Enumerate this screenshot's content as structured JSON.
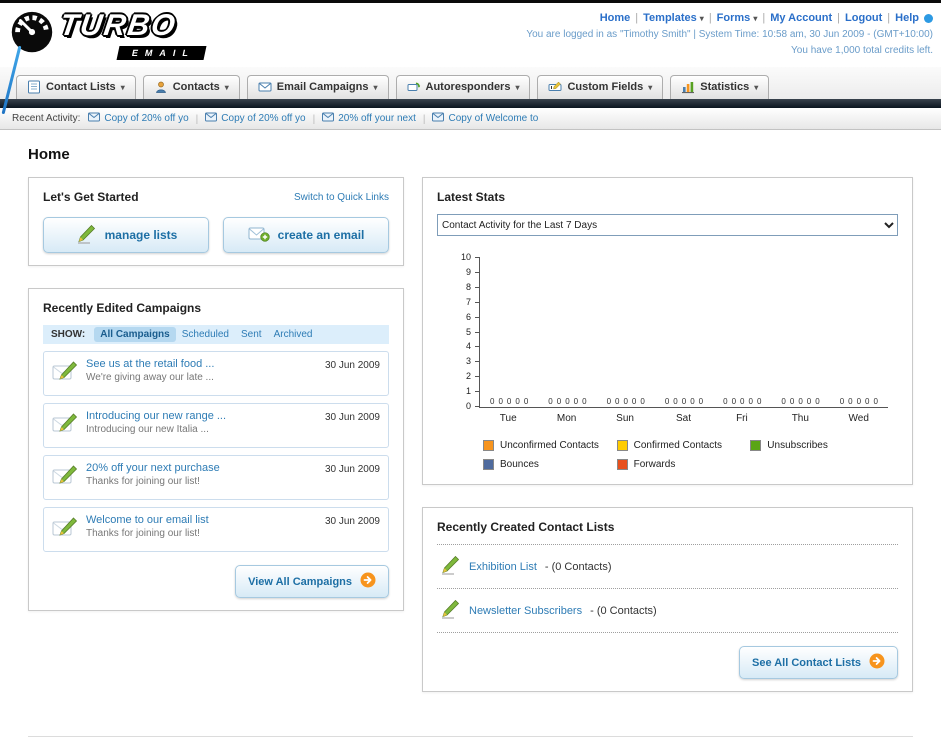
{
  "header": {
    "logo": {
      "line1": "TURBO",
      "line2": "EMAIL"
    },
    "nav_links": [
      {
        "label": "Home",
        "dropdown": false
      },
      {
        "label": "Templates",
        "dropdown": true
      },
      {
        "label": "Forms",
        "dropdown": true
      },
      {
        "label": "My Account",
        "dropdown": false
      },
      {
        "label": "Logout",
        "dropdown": false
      },
      {
        "label": "Help",
        "dropdown": false
      }
    ],
    "login_info": "You are logged in as \"Timothy Smith\" | System Time: 10:58 am, 30 Jun 2009 - (GMT+10:00)",
    "credits_info": "You have 1,000 total credits left."
  },
  "main_nav": {
    "tabs": [
      {
        "label": "Contact Lists",
        "icon": "list"
      },
      {
        "label": "Contacts",
        "icon": "person"
      },
      {
        "label": "Email Campaigns",
        "icon": "envelope"
      },
      {
        "label": "Autoresponders",
        "icon": "autoresponder"
      },
      {
        "label": "Custom Fields",
        "icon": "field"
      },
      {
        "label": "Statistics",
        "icon": "barchart"
      }
    ]
  },
  "recent_activity": {
    "label": "Recent Activity:",
    "items": [
      "Copy of 20% off yo",
      "Copy of 20% off yo",
      "20% off your next",
      "Copy of Welcome to"
    ]
  },
  "page_title": "Home",
  "get_started": {
    "title": "Let's Get Started",
    "switch_link": "Switch to Quick Links",
    "buttons": [
      {
        "label": "manage lists",
        "icon": "pencil"
      },
      {
        "label": "create an email",
        "icon": "envelope-plus"
      }
    ]
  },
  "campaigns": {
    "title": "Recently Edited Campaigns",
    "show_label": "SHOW:",
    "filters": [
      "All Campaigns",
      "Scheduled",
      "Sent",
      "Archived"
    ],
    "active_filter": "All Campaigns",
    "rows": [
      {
        "title": "See us at the retail food ...",
        "subtitle": "We're giving away our late ...",
        "date": "30 Jun 2009"
      },
      {
        "title": "Introducing our new range ...",
        "subtitle": "Introducing our new Italia ...",
        "date": "30 Jun 2009"
      },
      {
        "title": "20% off your next purchase",
        "subtitle": "Thanks for joining our list!",
        "date": "30 Jun 2009"
      },
      {
        "title": "Welcome to our email list",
        "subtitle": "Thanks for joining our list!",
        "date": "30 Jun 2009"
      }
    ],
    "view_all_label": "View All Campaigns"
  },
  "latest_stats": {
    "title": "Latest Stats",
    "dropdown_value": "Contact Activity for the Last 7 Days"
  },
  "chart_data": {
    "type": "bar",
    "title": "Contact Activity for the Last 7 Days",
    "categories": [
      "Tue",
      "Mon",
      "Sun",
      "Sat",
      "Fri",
      "Thu",
      "Wed"
    ],
    "series": [
      {
        "name": "Unconfirmed Contacts",
        "color": "#f7941d",
        "values": [
          0,
          0,
          0,
          0,
          0,
          0,
          0
        ]
      },
      {
        "name": "Confirmed Contacts",
        "color": "#ffcc00",
        "values": [
          0,
          0,
          0,
          0,
          0,
          0,
          0
        ]
      },
      {
        "name": "Unsubscribes",
        "color": "#5aa515",
        "values": [
          0,
          0,
          0,
          0,
          0,
          0,
          0
        ]
      },
      {
        "name": "Bounces",
        "color": "#4f6b9e",
        "values": [
          0,
          0,
          0,
          0,
          0,
          0,
          0
        ]
      },
      {
        "name": "Forwards",
        "color": "#e8501d",
        "values": [
          0,
          0,
          0,
          0,
          0,
          0,
          0
        ]
      }
    ],
    "ylim": [
      0,
      10
    ],
    "ytick_step": 1,
    "grid": false,
    "legend_position": "bottom"
  },
  "contact_lists": {
    "title": "Recently Created Contact Lists",
    "items": [
      {
        "name": "Exhibition List",
        "detail": "- (0 Contacts)"
      },
      {
        "name": "Newsletter Subscribers",
        "detail": "- (0 Contacts)"
      }
    ],
    "see_all_label": "See All Contact Lists"
  },
  "colors": {
    "link": "#2e7cb5",
    "dark_bar": "#0b1620",
    "accent_orange": "#f7941d"
  }
}
